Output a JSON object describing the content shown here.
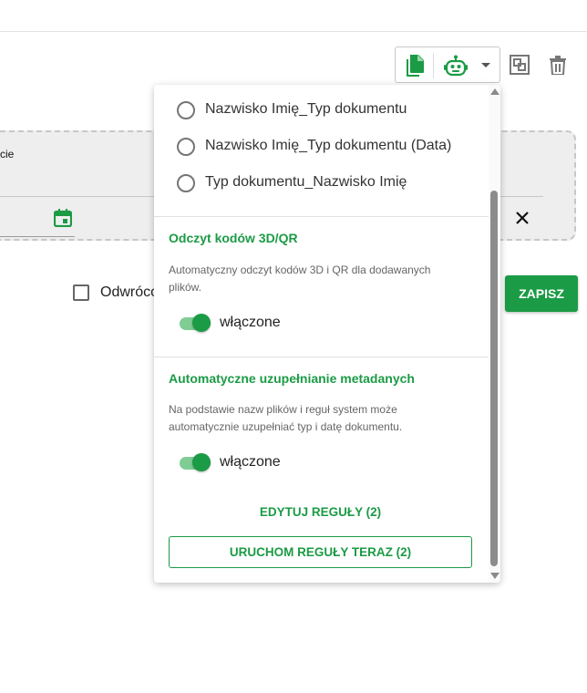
{
  "colors": {
    "accent": "#1b9b45",
    "accent_light": "#7fcc95",
    "card_bg": "#eeeeee"
  },
  "toolbar": {
    "icons": [
      "document-copy-icon",
      "robot-icon",
      "chevron-down-icon",
      "split-icon",
      "trash-icon"
    ]
  },
  "card": {
    "field_label_partial": "cie",
    "icons": [
      "calendar-icon",
      "close-icon"
    ]
  },
  "reverse_checkbox": {
    "label_partial": "Odwróco",
    "checked": false
  },
  "save_button": {
    "label": "ZAPISZ"
  },
  "dropdown": {
    "naming_options": [
      {
        "label": "Nazwisko Imię_Typ dokumentu",
        "selected": false
      },
      {
        "label": "Nazwisko Imię_Typ dokumentu (Data)",
        "selected": false
      },
      {
        "label": "Typ dokumentu_Nazwisko Imię",
        "selected": false
      }
    ],
    "qr_section": {
      "title": "Odczyt kodów 3D/QR",
      "description": "Automatyczny odczyt kodów 3D i QR dla dodawanych plików.",
      "toggle_label": "włączone",
      "enabled": true
    },
    "metadata_section": {
      "title": "Automatyczne uzupełnianie metadanych",
      "description": "Na podstawie nazw plików i reguł system może automatycznie uzupełniać typ i datę dokumentu.",
      "toggle_label": "włączone",
      "enabled": true
    },
    "edit_rules_label": "EDYTUJ REGUŁY (2)",
    "run_rules_label": "URUCHOM REGUŁY TERAZ (2)"
  }
}
